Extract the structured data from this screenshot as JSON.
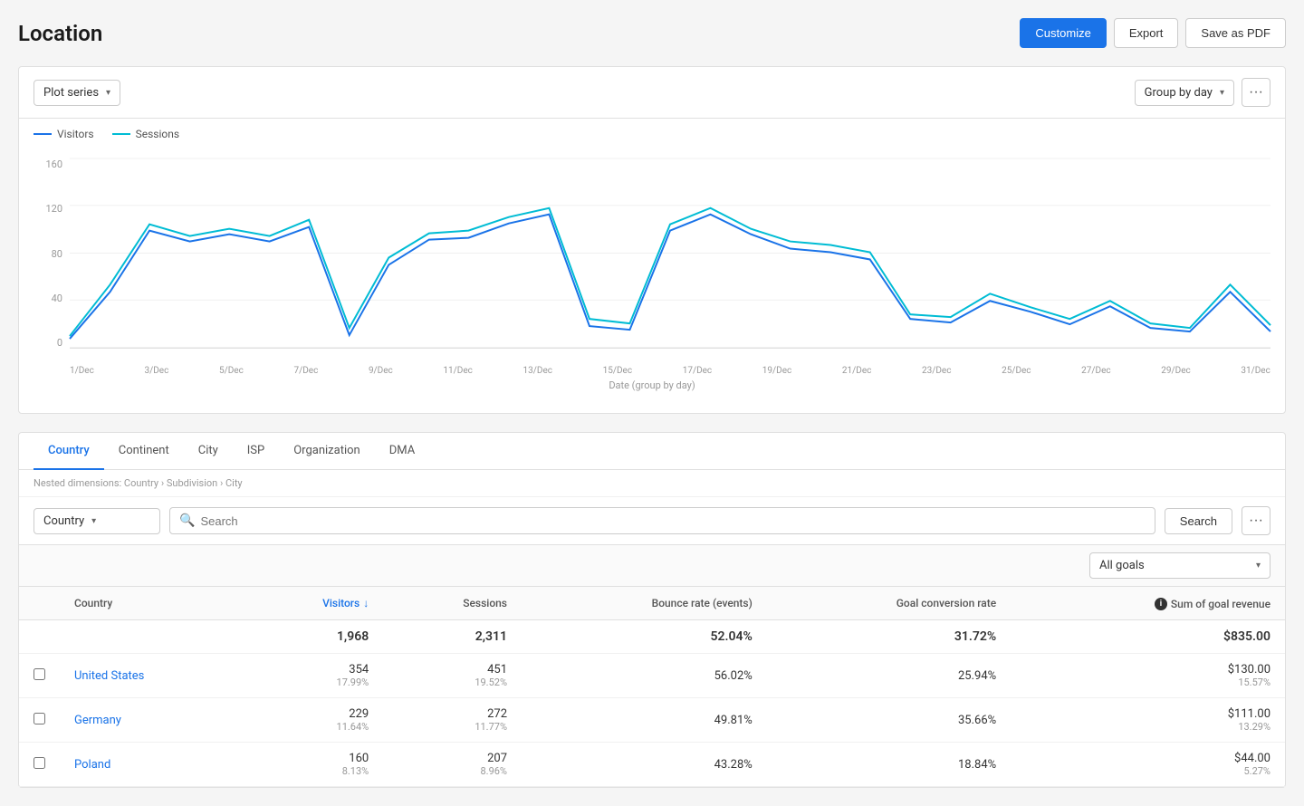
{
  "page": {
    "title": "Location",
    "buttons": {
      "customize": "Customize",
      "export": "Export",
      "save_as": "Save as PDF"
    }
  },
  "chart": {
    "plot_series_label": "Plot series",
    "group_by_label": "Group by day",
    "legend": {
      "visitors": "Visitors",
      "sessions": "Sessions"
    },
    "x_axis_title": "Date (group by day)",
    "x_labels": [
      "1/Dec",
      "3/Dec",
      "5/Dec",
      "7/Dec",
      "9/Dec",
      "11/Dec",
      "13/Dec",
      "15/Dec",
      "17/Dec",
      "19/Dec",
      "21/Dec",
      "23/Dec",
      "25/Dec",
      "27/Dec",
      "29/Dec",
      "31/Dec"
    ],
    "y_labels": [
      "160",
      "120",
      "80",
      "40",
      "0"
    ]
  },
  "tabs": {
    "items": [
      {
        "label": "Country",
        "active": true
      },
      {
        "label": "Continent",
        "active": false
      },
      {
        "label": "City",
        "active": false
      },
      {
        "label": "ISP",
        "active": false
      },
      {
        "label": "Organization",
        "active": false
      },
      {
        "label": "DMA",
        "active": false
      }
    ]
  },
  "nested_label": "Nested dimensions: Country › Subdivision › City",
  "table": {
    "dimension_select": "Country",
    "search_placeholder": "Search",
    "search_button": "Search",
    "goals_select": "All goals",
    "more_button": "···",
    "columns": {
      "country": "Country",
      "visitors": "Visitors",
      "sessions": "Sessions",
      "bounce_rate": "Bounce rate (events)",
      "goal_conversion": "Goal conversion rate",
      "goal_revenue": "Sum of goal revenue"
    },
    "totals": {
      "visitors": "1,968",
      "sessions": "2,311",
      "bounce_rate": "52.04%",
      "goal_conversion": "31.72%",
      "goal_revenue": "$835.00"
    },
    "rows": [
      {
        "country": "United States",
        "visitors": "354",
        "visitors_pct": "17.99%",
        "sessions": "451",
        "sessions_pct": "19.52%",
        "bounce_rate": "56.02%",
        "goal_conversion": "25.94%",
        "goal_revenue": "$130.00",
        "goal_revenue_pct": "15.57%"
      },
      {
        "country": "Germany",
        "visitors": "229",
        "visitors_pct": "11.64%",
        "sessions": "272",
        "sessions_pct": "11.77%",
        "bounce_rate": "49.81%",
        "goal_conversion": "35.66%",
        "goal_revenue": "$111.00",
        "goal_revenue_pct": "13.29%"
      },
      {
        "country": "Poland",
        "visitors": "160",
        "visitors_pct": "8.13%",
        "sessions": "207",
        "sessions_pct": "8.96%",
        "bounce_rate": "43.28%",
        "goal_conversion": "18.84%",
        "goal_revenue": "$44.00",
        "goal_revenue_pct": "5.27%"
      }
    ]
  }
}
